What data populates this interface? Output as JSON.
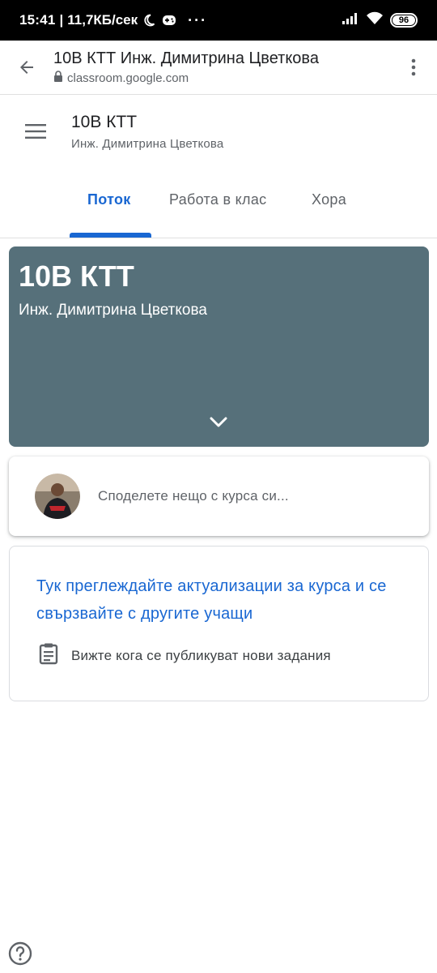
{
  "status_bar": {
    "time": "15:41",
    "separator": "|",
    "network_speed": "11,7КБ/сек",
    "dots": "···",
    "battery": "96",
    "icons": [
      "moon-icon",
      "gamepad-icon",
      "signal-icon",
      "wifi-icon",
      "battery-icon"
    ]
  },
  "browser": {
    "title": "10В КТТ Инж. Димитрина Цветкова",
    "url": "classroom.google.com",
    "icons": [
      "back-arrow-icon",
      "lock-icon",
      "more-vert-icon"
    ]
  },
  "class_header": {
    "name": "10В КТТ",
    "teacher": "Инж. Димитрина Цветкова"
  },
  "tabs": [
    {
      "label": "Поток",
      "active": true
    },
    {
      "label": "Работа в клас",
      "active": false
    },
    {
      "label": "Хора",
      "active": false
    }
  ],
  "banner": {
    "name": "10В КТТ",
    "teacher": "Инж. Димитрина Цветкова",
    "color": "#56707a"
  },
  "share": {
    "prompt": "Споделете нещо с курса си..."
  },
  "info_card": {
    "headline": "Тук преглеждайте актуализации за курса и се свързвайте с другите учащи",
    "hint": "Вижте кога се публикуват нови задания"
  },
  "colors": {
    "accent": "#1967d2",
    "banner": "#56707a"
  }
}
